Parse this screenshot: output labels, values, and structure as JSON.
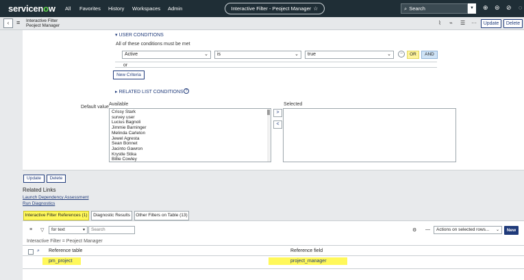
{
  "nav": {
    "logo_pre": "servicen",
    "logo_o": "o",
    "logo_post": "w",
    "links": [
      "All",
      "Favorites",
      "History",
      "Workspaces",
      "Admin"
    ],
    "page_title": "Interactive Filter - Peoject Manager",
    "search_placeholder": "Search",
    "icons": [
      "globe-icon",
      "chat-icon",
      "help-icon",
      "bell-icon"
    ]
  },
  "record": {
    "title_line1": "Interactive Filter",
    "title_line2": "Peoject Manager",
    "update_label": "Update",
    "delete_label": "Delete",
    "icons": [
      "paperclip-icon",
      "activity-icon",
      "settings-icon",
      "more-icon"
    ]
  },
  "conditions": {
    "section_label": "USER CONDITIONS",
    "all_met_label": "All of these conditions must be met",
    "field": "Active",
    "operator": "is",
    "value": "true",
    "or_label": "OR",
    "and_label": "AND",
    "or_separator": "or",
    "new_criteria_label": "New Criteria",
    "related_list_label": "RELATED LIST CONDITIONS"
  },
  "default_value": {
    "label": "Default value",
    "available_label": "Available",
    "selected_label": "Selected",
    "available_items": [
      "Crissy Stark",
      "survey user",
      "Lucius Bagnoli",
      "Jimmie Barninger",
      "Melinda Carleton",
      "Jewel Agresta",
      "Sean Bonnet",
      "Jacinto Gawron",
      "Krystle Stika",
      "Billie Cowley"
    ],
    "add_arrow": ">",
    "remove_arrow": "<"
  },
  "footer_buttons": {
    "update_label": "Update",
    "delete_label": "Delete"
  },
  "related_links": {
    "title": "Related Links",
    "links": [
      "Launch Dependency Assessment",
      "Run Diagnostics"
    ]
  },
  "tabs": [
    {
      "label": "Interactive Filter References (1)",
      "active": true
    },
    {
      "label": "Diagnostic Results",
      "active": false
    },
    {
      "label": "Other Filters on Table (13)",
      "active": false
    }
  ],
  "related_list": {
    "search_field": "for text",
    "search_placeholder": "Search",
    "actions_label": "Actions on selected rows...",
    "new_label": "New",
    "breadcrumb": "Interactive Filter = Peoject Manager",
    "columns": [
      "Reference table",
      "Reference field"
    ],
    "rows": [
      {
        "table": "pm_project",
        "field": "project_manager"
      }
    ]
  },
  "colors": {
    "nav_bg": "#1f2e36",
    "brand_green": "#62d84e",
    "link_blue": "#1f3a7a",
    "highlight_yellow": "#fff85a"
  }
}
